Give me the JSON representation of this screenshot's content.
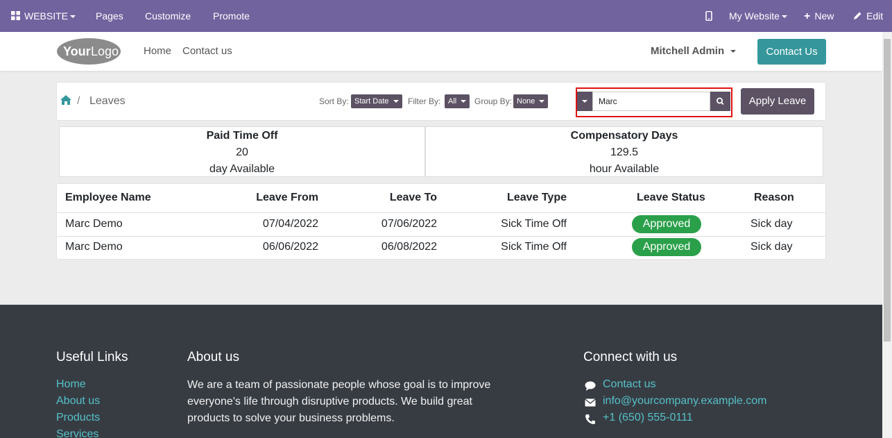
{
  "adminbar": {
    "website_menu": "WEBSITE",
    "pages": "Pages",
    "customize": "Customize",
    "promote": "Promote",
    "my_website": "My Website",
    "new": "New",
    "edit": "Edit"
  },
  "header": {
    "logo_text_1": "Your",
    "logo_text_2": "Logo",
    "nav": [
      "Home",
      "Contact us"
    ],
    "user": "Mitchell Admin",
    "contact_button": "Contact Us"
  },
  "panel": {
    "breadcrumb": "Leaves",
    "sort_label": "Sort By:",
    "sort_value": "Start Date",
    "filter_label": "Filter By:",
    "filter_value": "All",
    "group_label": "Group By:",
    "group_value": "None",
    "search_value": "Marc",
    "apply_button": "Apply Leave"
  },
  "summary": [
    {
      "title": "Paid Time Off",
      "value": "20",
      "unit": "day Available"
    },
    {
      "title": "Compensatory Days",
      "value": "129.5",
      "unit": "hour Available"
    }
  ],
  "table": {
    "headers": [
      "Employee Name",
      "Leave From",
      "Leave To",
      "Leave Type",
      "Leave Status",
      "Reason"
    ],
    "rows": [
      {
        "name": "Marc Demo",
        "from": "07/04/2022",
        "to": "07/06/2022",
        "type": "Sick Time Off",
        "status": "Approved",
        "reason": "Sick day"
      },
      {
        "name": "Marc Demo",
        "from": "06/06/2022",
        "to": "06/08/2022",
        "type": "Sick Time Off",
        "status": "Approved",
        "reason": "Sick day"
      }
    ]
  },
  "footer": {
    "useful_links_title": "Useful Links",
    "useful_links": [
      "Home",
      "About us",
      "Products",
      "Services"
    ],
    "about_title": "About us",
    "about_text": "We are a team of passionate people whose goal is to improve everyone's life through disruptive products. We build great products to solve your business problems.",
    "connect_title": "Connect with us",
    "connect": [
      {
        "icon": "comment-icon",
        "text": "Contact us"
      },
      {
        "icon": "envelope-icon",
        "text": "info@yourcompany.example.com"
      },
      {
        "icon": "phone-icon",
        "text": "+1 (650) 555-0111"
      }
    ]
  },
  "colors": {
    "admin_bar": "#71639e",
    "accent_teal": "#35979c",
    "dark_button": "#5c5264",
    "approved_green": "#2aa04a",
    "footer_bg": "#373c43",
    "footer_link": "#56c1c8"
  }
}
